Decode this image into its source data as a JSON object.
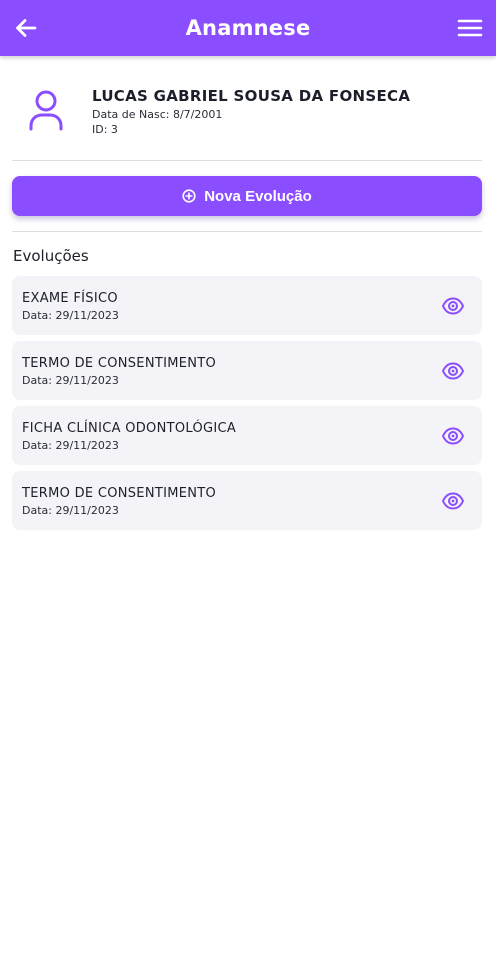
{
  "colors": {
    "accent": "#8a4dff",
    "card_bg": "#f4f4f8"
  },
  "header": {
    "title": "Anamnese",
    "back_icon": "arrow-left-icon",
    "menu_icon": "hamburger-menu-icon"
  },
  "patient": {
    "name": "LUCAS GABRIEL SOUSA DA FONSECA",
    "birth": "Data de Nasc: 8/7/2001",
    "id": "ID: 3",
    "avatar_icon": "user-icon"
  },
  "new_evolution": {
    "label": "Nova Evolução",
    "icon": "plus-circle-icon"
  },
  "evolutions": {
    "title": "Evoluções",
    "items": [
      {
        "title": "EXAME FÍSICO",
        "date": "Data: 29/11/2023",
        "icon": "eye-icon"
      },
      {
        "title": "TERMO DE CONSENTIMENTO",
        "date": "Data: 29/11/2023",
        "icon": "eye-icon"
      },
      {
        "title": "FICHA CLÍNICA ODONTOLÓGICA",
        "date": "Data: 29/11/2023",
        "icon": "eye-icon"
      },
      {
        "title": "TERMO DE CONSENTIMENTO",
        "date": "Data: 29/11/2023",
        "icon": "eye-icon"
      }
    ]
  }
}
